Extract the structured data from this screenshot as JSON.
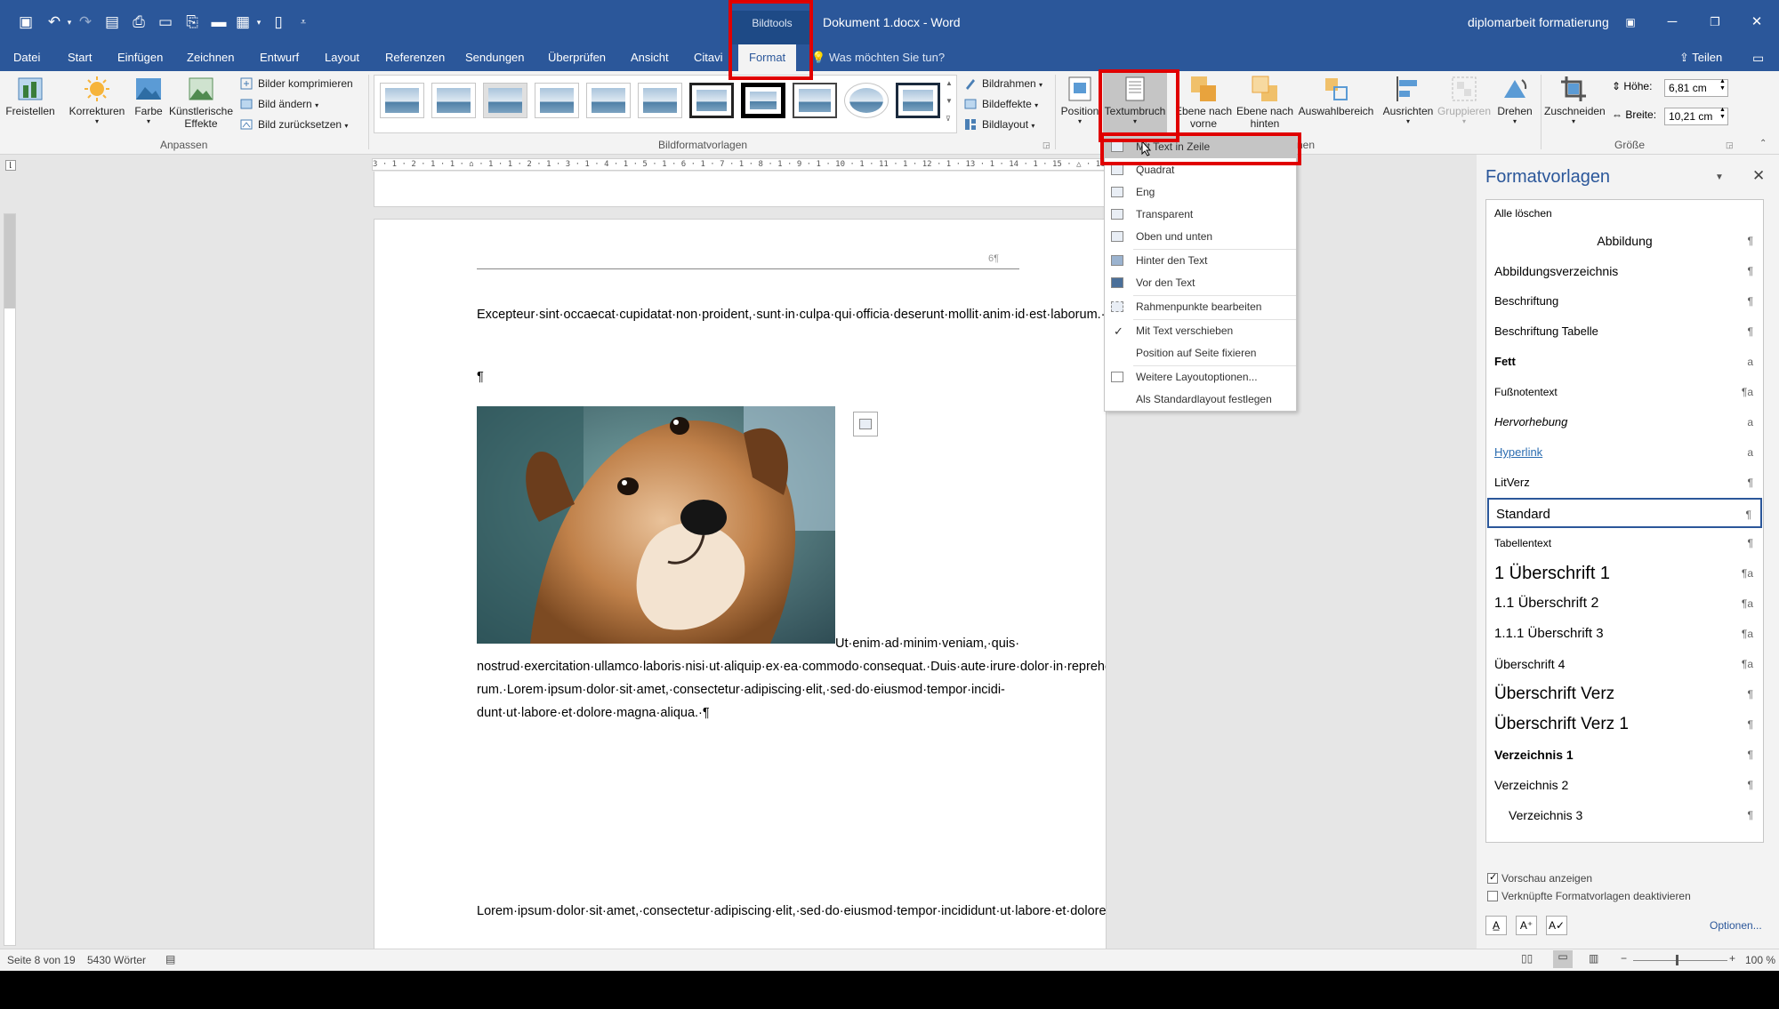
{
  "window": {
    "doc_title": "Dokument 1.docx - Word",
    "context_group": "Bildtools",
    "user": "diplomarbeit formatierung"
  },
  "tabs": [
    {
      "label": "Datei"
    },
    {
      "label": "Start"
    },
    {
      "label": "Einfügen"
    },
    {
      "label": "Zeichnen"
    },
    {
      "label": "Entwurf"
    },
    {
      "label": "Layout"
    },
    {
      "label": "Referenzen"
    },
    {
      "label": "Sendungen"
    },
    {
      "label": "Überprüfen"
    },
    {
      "label": "Ansicht"
    },
    {
      "label": "Citavi"
    },
    {
      "label": "Format"
    }
  ],
  "tellme": "Was möchten Sie tun?",
  "share": "Teilen",
  "ribbon": {
    "freistellen": "Freistellen",
    "korrekturen": "Korrekturen",
    "farbe": "Farbe",
    "kuenstlerische_1": "Künstlerische",
    "kuenstlerische_2": "Effekte",
    "bilder_komprimieren": "Bilder komprimieren",
    "bild_aendern": "Bild ändern",
    "bild_zuruecksetzen": "Bild zurücksetzen",
    "group_anpassen": "Anpassen",
    "group_bildformatvorlagen": "Bildformatvorlagen",
    "bildrahmen": "Bildrahmen",
    "bildeffekte": "Bildeffekte",
    "bildlayout": "Bildlayout",
    "position": "Position",
    "textumbruch": "Textumbruch",
    "ebene_vorne_1": "Ebene nach",
    "ebene_vorne_2": "vorne",
    "ebene_hinten_1": "Ebene nach",
    "ebene_hinten_2": "hinten",
    "auswahlbereich": "Auswahlbereich",
    "ausrichten": "Ausrichten",
    "gruppieren": "Gruppieren",
    "drehen": "Drehen",
    "group_anordnen_tail": "nen",
    "zuschneiden": "Zuschneiden",
    "hoehe_label": "Höhe:",
    "hoehe_value": "6,81 cm",
    "breite_label": "Breite:",
    "breite_value": "10,21 cm",
    "group_groesse": "Größe"
  },
  "ruler_text": "3 · 1 · 2 · 1 · 1 · ⌂ · 1 · 1 · 2 · 1 · 3 · 1 · 4 · 1 · 5 · 1 · 6 · 1 · 7 · 1 · 8 · 1 · 9 · 1 · 10 · 1 · 11 · 1 · 12 · 1 · 13 · 1 · 14 · 1 · 15 · △ · 16 · 1 · 17",
  "document": {
    "page_number": "6¶",
    "para1": "Excepteur·sint·occaecat·cupidatat·non·proident,·sunt·in·culpa·qui·officia·deserunt·mollit·anim·id·est·laborum.·¶",
    "empty_mark": "¶",
    "para2_first": "Ut·enim·ad·minim·veniam,·quis·",
    "para2_rest": "nostrud·exercitation·ullamco·laboris·nisi·ut·aliquip·ex·ea·commodo·consequat.·Duis·aute·irure·dolor·in·reprehenderit·in·voluptate·velit·esse·cillum·dolore·eu·fugiat·nulla·pariatur.·Excepteur·sint·occaecat·cupidatat·non·proident,·sunt·in·culpa·qui·officia·deserunt·mollit·anim·id·est·laborum.·Lorem·ipsum·dolor·sit·amet,·consectetur·adipiscing·elit,·sed·do·eiusmod·tempor·incididunt·ut·labore·et·dolore·magna·aliqua.·Ut·enim·ad·minim·veniam,·quis·nostrud·exercitation·ullamco·laboris·nisi·ut·aliquip·ex·ea·commodo·consequat.·Duis·aute·irure·dolor·in·reprehenderit·in·voluptate·velit·esse·cillum·dolore·eu·fugiat·nulla·pariatur.·Excepteur·sint·occaecat·cupidatat·non·proident,·sunt·in·culpa·qui·officia·deserunt·mollit·anim·id·est·labo-rum.·Lorem·ipsum·dolor·sit·amet,·consectetur·adipiscing·elit,·sed·do·eiusmod·tempor·incidi-dunt·ut·labore·et·dolore·magna·aliqua.·¶",
    "para3": "Lorem·ipsum·dolor·sit·amet,·consectetur·adipiscing·elit,·sed·do·eiusmod·tempor·incididunt·ut·labore·et·dolore·magna·aliqua.·Ut·enim·ad·minim·veniam,·quis·nostrud·exercitation·"
  },
  "dropdown": {
    "items": [
      {
        "label": "Mit Text in Zeile",
        "icon": "inline-wrap-icon"
      },
      {
        "label": "Quadrat",
        "icon": "square-wrap-icon"
      },
      {
        "label": "Eng",
        "icon": "tight-wrap-icon"
      },
      {
        "label": "Transparent",
        "icon": "through-wrap-icon"
      },
      {
        "label": "Oben und unten",
        "icon": "top-bottom-wrap-icon"
      },
      {
        "label": "Hinter den Text",
        "icon": "behind-text-icon"
      },
      {
        "label": "Vor den Text",
        "icon": "in-front-text-icon"
      },
      {
        "label": "Rahmenpunkte bearbeiten",
        "icon": "edit-wrap-points-icon"
      },
      {
        "label": "Mit Text verschieben",
        "checked": true
      },
      {
        "label": "Position auf Seite fixieren"
      },
      {
        "label": "Weitere Layoutoptionen...",
        "icon": "layout-options-icon"
      },
      {
        "label": "Als Standardlayout festlegen"
      }
    ]
  },
  "styles_pane": {
    "title": "Formatvorlagen",
    "clear_all": "Alle löschen",
    "items": [
      {
        "label": "Abbildung",
        "mark": "¶"
      },
      {
        "label": "Abbildungsverzeichnis",
        "mark": "¶"
      },
      {
        "label": "Beschriftung",
        "mark": "¶"
      },
      {
        "label": "Beschriftung Tabelle",
        "mark": "¶"
      },
      {
        "label": "Fett",
        "mark": "a"
      },
      {
        "label": "Fußnotentext",
        "mark": "¶a"
      },
      {
        "label": "Hervorhebung",
        "mark": "a"
      },
      {
        "label": "Hyperlink",
        "mark": "a"
      },
      {
        "label": "LitVerz",
        "mark": "¶"
      },
      {
        "label": "Standard",
        "mark": "¶"
      },
      {
        "label": "Tabellentext",
        "mark": "¶"
      },
      {
        "label": "1  Überschrift 1",
        "mark": "¶a"
      },
      {
        "label": "1.1  Überschrift 2",
        "mark": "¶a"
      },
      {
        "label": "1.1.1  Überschrift 3",
        "mark": "¶a"
      },
      {
        "label": "Überschrift 4",
        "mark": "¶a"
      },
      {
        "label": "Überschrift Verz",
        "mark": "¶"
      },
      {
        "label": "Überschrift Verz 1",
        "mark": "¶"
      },
      {
        "label": "Verzeichnis 1",
        "mark": "¶"
      },
      {
        "label": "Verzeichnis 2",
        "mark": "¶"
      },
      {
        "label": "Verzeichnis 3",
        "mark": "¶"
      }
    ],
    "preview_label": "Vorschau anzeigen",
    "preview_checked": true,
    "linked_label": "Verknüpfte Formatvorlagen deaktivieren",
    "linked_checked": false,
    "options": "Optionen..."
  },
  "status": {
    "page": "Seite 8 von 19",
    "words": "5430 Wörter",
    "zoom": "100 %"
  },
  "colors": {
    "accent": "#2b579a",
    "highlight": "#e00000"
  }
}
